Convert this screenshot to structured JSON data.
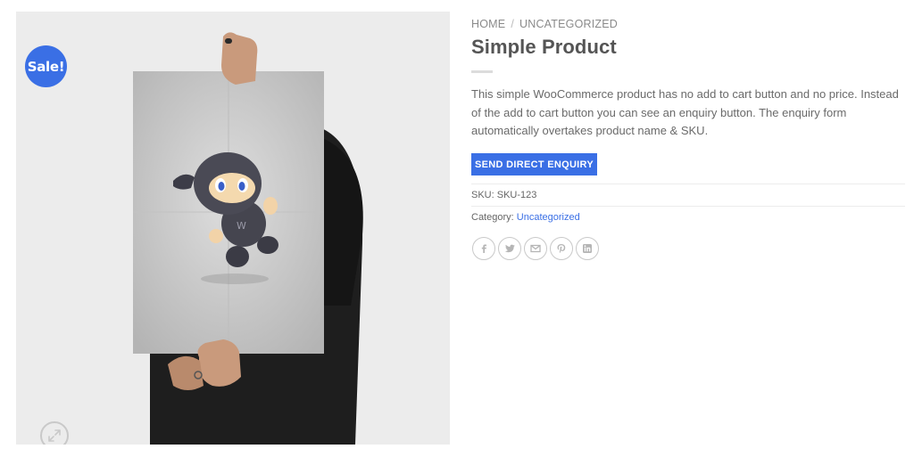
{
  "gallery": {
    "badge": "Sale!",
    "image_alt": "Person holding a poster of the WooCommerce ninja mascot",
    "zoom_icon": "expand-icon"
  },
  "breadcrumb": {
    "home": "HOME",
    "separator": "/",
    "category": "UNCATEGORIZED"
  },
  "product": {
    "title": "Simple Product",
    "description": "This simple WooCommerce product has no add to cart button and no price. Instead of the add to cart button you can see an enquiry button. The enquiry form automatically overtakes product name & SKU.",
    "enquiry_button": "SEND DIRECT ENQUIRY"
  },
  "meta": {
    "sku_label": "SKU:",
    "sku_value": "SKU-123",
    "category_label": "Category:",
    "category_value": "Uncategorized"
  },
  "share": {
    "icons": [
      "facebook-icon",
      "twitter-icon",
      "email-icon",
      "pinterest-icon",
      "linkedin-icon"
    ]
  },
  "colors": {
    "accent": "#3a6fe5",
    "text": "#555555",
    "muted": "#8a8a8a"
  }
}
